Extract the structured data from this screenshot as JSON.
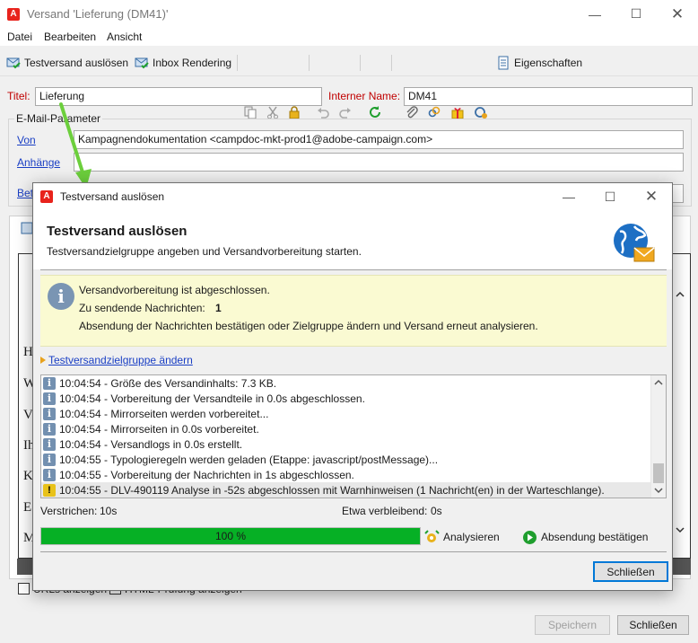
{
  "main": {
    "window_title": "Versand 'Lieferung (DM41)'",
    "menu": [
      "Datei",
      "Bearbeiten",
      "Ansicht"
    ],
    "toolbar": {
      "test_send": "Testversand auslösen",
      "inbox_rendering": "Inbox Rendering",
      "properties": "Eigenschaften"
    },
    "title_label": "Titel:",
    "title_value": "Lieferung",
    "internal_name_label": "Interner Name:",
    "internal_name_value": "DM41",
    "email_params_legend": "E-Mail-Parameter",
    "from_label": "Von",
    "from_value": "Kampagnendokumentation <campdoc-mkt-prod1@adobe-campaign.com>",
    "attachments_label": "Anhänge",
    "subject_label_partial": "Bet",
    "left_letters": [
      "H",
      "W",
      "V",
      "Ih",
      "K",
      "E",
      "M"
    ],
    "bottom_checkbox_1": "URLs anzeigen",
    "bottom_checkbox_2": "HTML-Prüfung anzeigen",
    "save_button": "Speichern",
    "close_button": "Schließen"
  },
  "dialog": {
    "title": "Testversand auslösen",
    "heading": "Testversand auslösen",
    "subheading": "Testversandzielgruppe angeben und Versandvorbereitung starten.",
    "info_line1": "Versandvorbereitung ist abgeschlossen.",
    "info_line2_label": "Zu sendende Nachrichten:",
    "info_line2_value": "1",
    "info_line3": "Absendung der Nachrichten bestätigen oder Zielgruppe ändern und Versand erneut analysieren.",
    "change_target_link": "Testversandzielgruppe ändern",
    "log": [
      {
        "type": "info",
        "text": "10:04:54 - Größe des Versandinhalts: 7.3 KB."
      },
      {
        "type": "info",
        "text": "10:04:54 - Vorbereitung der Versandteile in 0.0s abgeschlossen."
      },
      {
        "type": "info",
        "text": "10:04:54 - Mirrorseiten werden vorbereitet..."
      },
      {
        "type": "info",
        "text": "10:04:54 - Mirrorseiten in 0.0s vorbereitet."
      },
      {
        "type": "info",
        "text": "10:04:54 - Versandlogs in 0.0s erstellt."
      },
      {
        "type": "info",
        "text": "10:04:55 - Typologieregeln werden geladen (Etappe: javascript/postMessage)..."
      },
      {
        "type": "info",
        "text": "10:04:55 - Vorbereitung der Nachrichten in 1s abgeschlossen."
      },
      {
        "type": "warn",
        "text": "10:04:55 - DLV-490119 Analyse in -52s abgeschlossen mit Warnhinweisen (1 Nachricht(en) in der Warteschlange)."
      }
    ],
    "elapsed_label": "Verstrichen:",
    "elapsed_value": "10s",
    "remaining_label": "Etwa verbleibend:",
    "remaining_value": "0s",
    "progress_percent": 100,
    "progress_text": "100 %",
    "analyze_button": "Analysieren",
    "confirm_button": "Absendung bestätigen",
    "close_button": "Schließen"
  },
  "colors": {
    "accent_red": "#e8231c",
    "progress_green": "#06b025",
    "link_blue": "#1a3fc4",
    "info_bg": "#fafad2"
  }
}
